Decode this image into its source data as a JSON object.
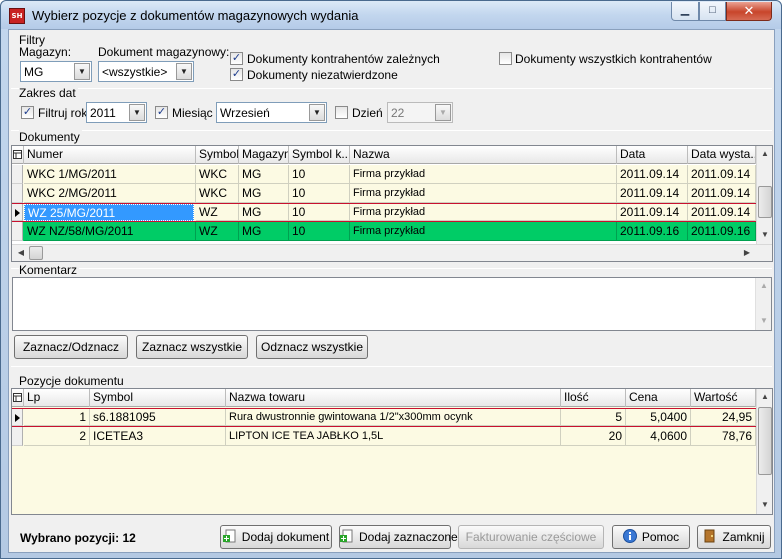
{
  "window": {
    "title": "Wybierz pozycje z dokumentów magazynowych wydania",
    "min": "▁",
    "max": "□",
    "close": "✕"
  },
  "filters": {
    "group": "Filtry",
    "magazyn_label": "Magazyn:",
    "magazyn_value": "MG",
    "dokument_label": "Dokument magazynowy:",
    "dokument_value": "<wszystkie>",
    "chk_zalezni": "Dokumenty kontrahentów zależnych",
    "chk_niezatw": "Dokumenty niezatwierdzone",
    "chk_wszyscy": "Dokumenty wszystkich kontrahentów"
  },
  "dates": {
    "group": "Zakres dat",
    "filtruj_rok": "Filtruj rok",
    "rok_value": "2011",
    "miesiac": "Miesiąc",
    "miesiac_value": "Wrzesień",
    "dzien": "Dzień",
    "dzien_value": "22"
  },
  "documents": {
    "group": "Dokumenty",
    "columns": [
      "Numer",
      "Symbol",
      "Magazyn",
      "Symbol k...",
      "Nazwa",
      "Data",
      "Data wysta..."
    ],
    "rows": [
      {
        "numer": "WKC 1/MG/2011",
        "symbol": "WKC",
        "magazyn": "MG",
        "symk": "10",
        "nazwa": "Firma przykład",
        "data": "2011.09.14",
        "datawys": "2011.09.14"
      },
      {
        "numer": "WKC 2/MG/2011",
        "symbol": "WKC",
        "magazyn": "MG",
        "symk": "10",
        "nazwa": "Firma przykład",
        "data": "2011.09.14",
        "datawys": "2011.09.14"
      },
      {
        "numer": "WZ 25/MG/2011",
        "symbol": "WZ",
        "magazyn": "MG",
        "symk": "10",
        "nazwa": "Firma przykład",
        "data": "2011.09.14",
        "datawys": "2011.09.14"
      },
      {
        "numer": "WZ NZ/58/MG/2011",
        "symbol": "WZ",
        "magazyn": "MG",
        "symk": "10",
        "nazwa": "Firma przykład",
        "data": "2011.09.16",
        "datawys": "2011.09.16"
      }
    ]
  },
  "comment": {
    "group": "Komentarz"
  },
  "buttons": {
    "zaznacz_odznacz": "Zaznacz/Odznacz",
    "zaznacz_wszystkie": "Zaznacz wszystkie",
    "odznacz_wszystkie": "Odznacz wszystkie"
  },
  "positions": {
    "group": "Pozycje dokumentu",
    "columns": [
      "Lp",
      "Symbol",
      "Nazwa towaru",
      "Ilość",
      "Cena",
      "Wartość"
    ],
    "rows": [
      {
        "lp": "1",
        "symbol": "s6.1881095",
        "nazwa": "Rura dwustronnie gwintowana 1/2\"x300mm ocynk",
        "ilosc": "5",
        "cena": "5,0400",
        "wartosc": "24,95"
      },
      {
        "lp": "2",
        "symbol": "ICETEA3",
        "nazwa": "LIPTON ICE TEA JABŁKO 1,5L",
        "ilosc": "20",
        "cena": "4,0600",
        "wartosc": "78,76"
      }
    ]
  },
  "footer": {
    "selected": "Wybrano pozycji: 12",
    "dodaj_dokument": "Dodaj dokument",
    "dodaj_zaznaczone": "Dodaj zaznaczone",
    "fakturowanie": "Fakturowanie częściowe",
    "pomoc": "Pomoc",
    "zamknij": "Zamknij"
  },
  "colors": {
    "selected_row": "#3399ff",
    "green_row": "#00cc66",
    "cream_row": "#fcfae3",
    "red_line": "#c8102e"
  }
}
